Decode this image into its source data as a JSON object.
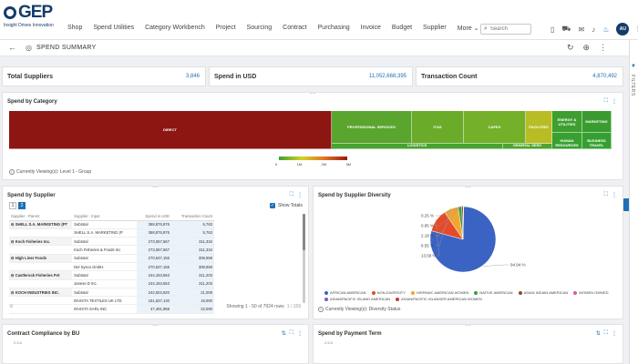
{
  "header": {
    "logo_text": "GEP",
    "logo_tagline": "Insight Drives Innovation",
    "nav": [
      "Shop",
      "Spend Utilities",
      "Category Workbench",
      "Project",
      "Sourcing",
      "Contract",
      "Purchasing",
      "Invoice",
      "Budget",
      "Supplier",
      "More"
    ],
    "search_placeholder": "Search",
    "avatar_initials": "AU"
  },
  "subbar": {
    "title": "SPEND SUMMARY"
  },
  "side_panel": {
    "label": "FILTERS"
  },
  "kpis": [
    {
      "label": "Total Suppliers",
      "value": "3,846"
    },
    {
      "label": "Spend in USD",
      "value": "11,052,668,395"
    },
    {
      "label": "Transaction Count",
      "value": "4,870,492"
    }
  ],
  "spend_by_category": {
    "title": "Spend by Category",
    "cells": [
      "DIRECT",
      "PROFESSIONAL SERVICES",
      "IT&S",
      "CAPEX",
      "FACILITIES",
      "ENERGY & UTILITIES",
      "MARKETING",
      "LOGISTICS",
      "HUMAN RESOURCES",
      "BUSINESS TRAVEL",
      "GENERAL SERV"
    ],
    "legend_ticks": [
      "0",
      "1M",
      "2M",
      "3M"
    ],
    "viewing_text": "Currently Viewing(s): Level 1 - Group"
  },
  "spend_by_supplier": {
    "title": "Spend by Supplier",
    "pages": [
      "1",
      "2"
    ],
    "show_totals_label": "Show Totals",
    "columns": [
      "Supplier - Parent",
      "Supplier - Input",
      "Spend in USD",
      "Transaction Count"
    ],
    "rows": [
      {
        "parent": "SHELL S.A. MARKETING (PT",
        "input": "Subtotal",
        "spend": "368,876,876",
        "count": "5,763"
      },
      {
        "parent": "",
        "input": "SHELL S.A. MARKETING (P",
        "spend": "368,876,876",
        "count": "5,763"
      },
      {
        "parent": "Koch Fisheries Inc.",
        "input": "Subtotal",
        "spend": "273,067,567",
        "count": "311,334"
      },
      {
        "parent": "",
        "input": "Koch Fisheries & Foods Inc",
        "spend": "273,067,567",
        "count": "311,334"
      },
      {
        "parent": "High Liner Foods",
        "input": "Subtotal",
        "spend": "270,537,155",
        "count": "308,959"
      },
      {
        "parent": "",
        "input": "Del Sysco GmbH.",
        "spend": "270,537,155",
        "count": "308,959"
      },
      {
        "parent": "Castlerock Fisheries Pvt",
        "input": "Subtotal",
        "spend": "244,163,563",
        "count": "311,203"
      },
      {
        "parent": "",
        "input": "Janese D Inc.",
        "spend": "244,163,563",
        "count": "311,203"
      },
      {
        "parent": "KOCH INDUSTRIES INC.",
        "input": "Subtotal",
        "spend": "242,503,920",
        "count": "21,009"
      },
      {
        "parent": "",
        "input": "INVISTA TEXTILES UK LTD",
        "spend": "191,637,130",
        "count": "19,000"
      },
      {
        "parent": "",
        "input": "INVISTA SARL INC",
        "spend": "47,491,958",
        "count": "22,000"
      }
    ],
    "showing_text": "Showing 1 - 50 of 7924 rows",
    "pager_text": "1 / 159"
  },
  "spend_by_diversity": {
    "title": "Spend by Supplier Diversity",
    "slice_labels": [
      "94.94 %",
      "13.58 %",
      "8.55 %",
      "2.18 %",
      "0.85 %",
      "0.25 %"
    ],
    "legend": [
      {
        "label": "AFRICAN AMERICAN",
        "color": "#3b63c4"
      },
      {
        "label": "NON-DIVERSITY",
        "color": "#e44b2b"
      },
      {
        "label": "HISPANIC AMERICAN WOMEN",
        "color": "#f2a630"
      },
      {
        "label": "NATIVE AMERICAN",
        "color": "#3e9b3a"
      },
      {
        "label": "ASIAN INDIAN AMERICAN",
        "color": "#8c4a2b"
      },
      {
        "label": "WOMEN OWNED",
        "color": "#d35aa6"
      },
      {
        "label": "ASIAN/PACIFIC ISLAND AMERICAN",
        "color": "#7b5fb8"
      },
      {
        "label": "ASIAN/PACIFIC ISLANDER AMERICAN WOMEN",
        "color": "#c23b3b"
      }
    ],
    "viewing_text": "Currently Viewing(s): Diversity Status"
  },
  "contract_compliance": {
    "title": "Contract Compliance by BU",
    "subtext": "2.5.6"
  },
  "payment_term": {
    "title": "Spend by Payment Term",
    "subtext": "2.5.6"
  }
}
